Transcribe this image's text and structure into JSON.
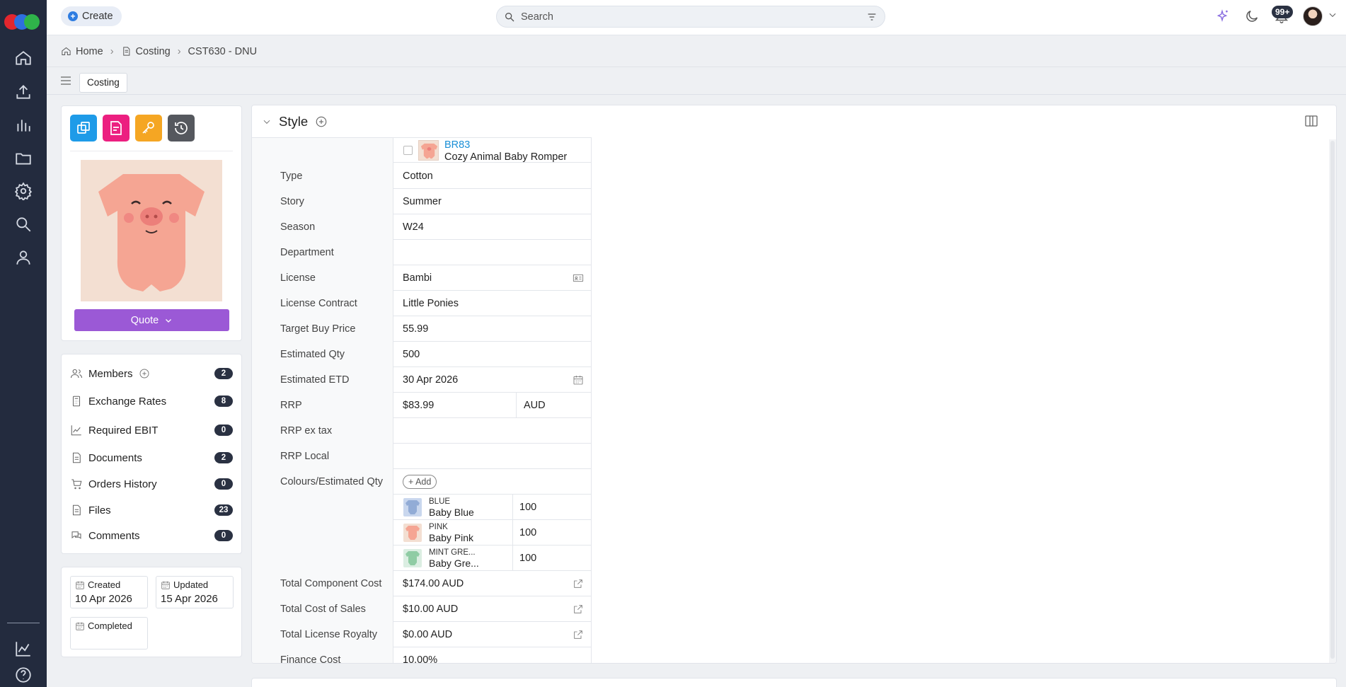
{
  "colors": {
    "rail": "#232b3e",
    "accent_blue": "#2f7de1",
    "quote_purple": "#9b59d6",
    "badge": "#2a3142",
    "link": "#1a8fd6"
  },
  "topbar": {
    "create_label": "Create",
    "search_placeholder": "Search",
    "notif_count": "99+"
  },
  "breadcrumb": {
    "home": "Home",
    "costing": "Costing",
    "current": "CST630 - DNU"
  },
  "tabs": {
    "active": "Costing"
  },
  "left": {
    "quote_label": "Quote",
    "menu": [
      {
        "label": "Members",
        "count": "2"
      },
      {
        "label": "Exchange Rates",
        "count": "8"
      },
      {
        "label": "Required EBIT",
        "count": "0"
      },
      {
        "label": "Documents",
        "count": "2"
      },
      {
        "label": "Orders History",
        "count": "0"
      },
      {
        "label": "Files",
        "count": "23"
      },
      {
        "label": "Comments",
        "count": "0"
      }
    ],
    "dates": {
      "created_label": "Created",
      "created_value": "10 Apr 2026",
      "updated_label": "Updated",
      "updated_value": "15 Apr 2026",
      "completed_label": "Completed",
      "completed_value": ""
    }
  },
  "style": {
    "section_title": "Style",
    "code": "BR83",
    "name": "Cozy Animal Baby Romper",
    "fields": [
      {
        "label": "Type",
        "value": "Cotton"
      },
      {
        "label": "Story",
        "value": "Summer"
      },
      {
        "label": "Season",
        "value": "W24"
      },
      {
        "label": "Department",
        "value": ""
      },
      {
        "label": "License",
        "value": "Bambi"
      },
      {
        "label": "License Contract",
        "value": "Little Ponies"
      },
      {
        "label": "Target Buy Price",
        "value": "55.99"
      },
      {
        "label": "Estimated Qty",
        "value": "500"
      },
      {
        "label": "Estimated ETD",
        "value": "30 Apr 2026"
      }
    ],
    "rrp": {
      "label": "RRP",
      "value": "$83.99",
      "currency": "AUD"
    },
    "rrp_ex_tax": {
      "label": "RRP ex tax",
      "value": ""
    },
    "rrp_local": {
      "label": "RRP Local",
      "value": ""
    },
    "colours_label": "Colours/Estimated Qty",
    "add_label": "+ Add",
    "colours": [
      {
        "code": "BLUE",
        "name": "Baby Blue",
        "qty": "100"
      },
      {
        "code": "PINK",
        "name": "Baby Pink",
        "qty": "100"
      },
      {
        "code": "MINT GRE...",
        "name": "Baby Gre...",
        "qty": "100"
      }
    ],
    "costs": [
      {
        "label": "Total Component Cost",
        "value": "$174.00 AUD"
      },
      {
        "label": "Total Cost of Sales",
        "value": "$10.00 AUD"
      },
      {
        "label": "Total License Royalty",
        "value": "$0.00 AUD"
      },
      {
        "label": "Finance Cost",
        "value": "10.00%"
      }
    ]
  }
}
